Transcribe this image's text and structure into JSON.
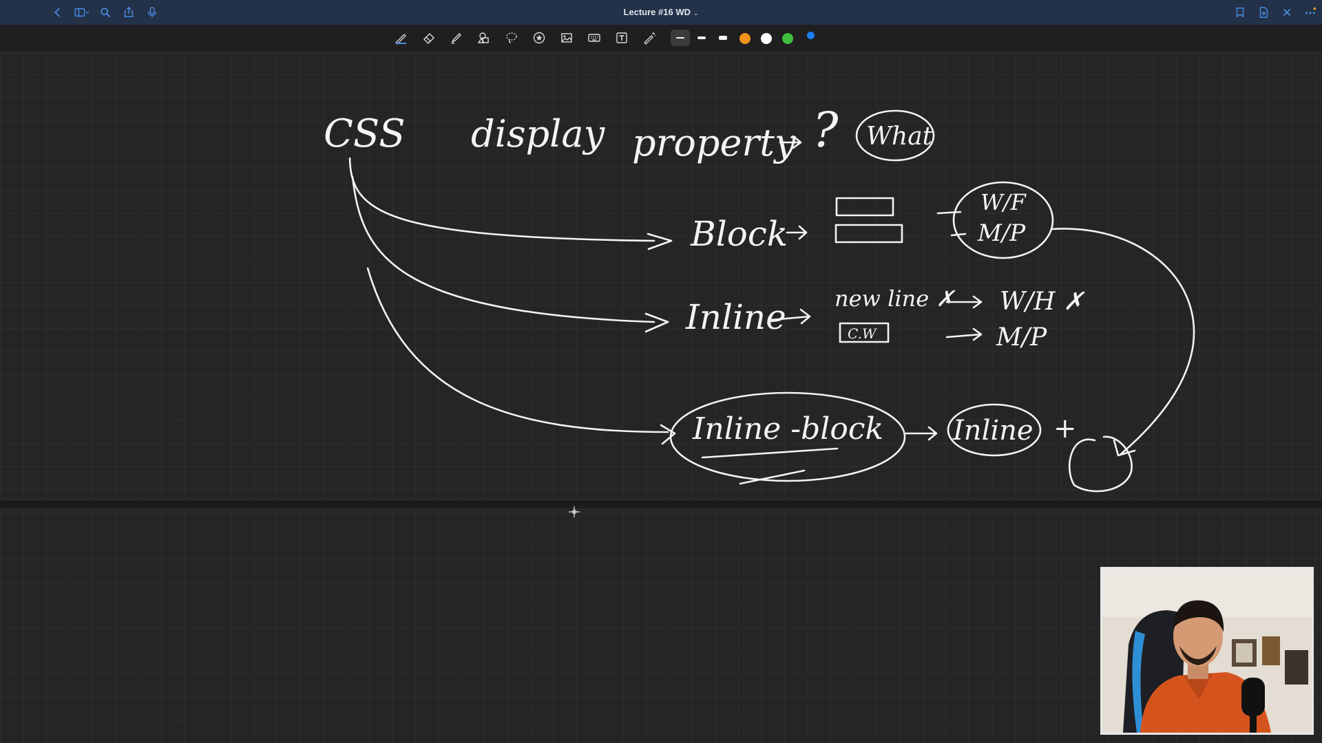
{
  "titlebar": {
    "title": "Lecture #16 WD",
    "left_icons": [
      "back-icon",
      "sidebar-icon",
      "search-icon",
      "share-icon",
      "microphone-icon"
    ],
    "right_icons": [
      "bookmark-icon",
      "add-page-icon",
      "close-icon",
      "more-icon"
    ]
  },
  "toolbar": {
    "tools": [
      "pen-tool-icon",
      "eraser-tool-icon",
      "highlighter-tool-icon",
      "shapes-tool-icon",
      "lasso-tool-icon",
      "sticker-tool-icon",
      "image-tool-icon",
      "keyboard-tool-icon",
      "text-tool-icon",
      "laser-pointer-icon"
    ],
    "stroke_sizes": [
      "thin",
      "medium",
      "thick"
    ],
    "selected_stroke": "thin",
    "colors": [
      "#f0921c",
      "#ffffff",
      "#3fbf3f",
      "#1e7ef0"
    ],
    "accent": "#4a8fe8"
  },
  "whiteboard": {
    "heading_css": "CSS",
    "heading_display": "display",
    "heading_property": "property",
    "question_mark": "?",
    "circled_what": "What",
    "block_label": "Block",
    "block_note_1": "W/F",
    "block_note_2": "M/P",
    "inline_label": "Inline",
    "inline_note_line": "new line ✗",
    "inline_cw": "C.W",
    "inline_note_wh": "W/H ✗",
    "inline_note_mp": "M/P",
    "inline_block_label": "Inline -block",
    "inline_block_eq": "Inline",
    "plus": "+"
  },
  "webcam": {
    "description_icon": "presenter-webcam"
  }
}
